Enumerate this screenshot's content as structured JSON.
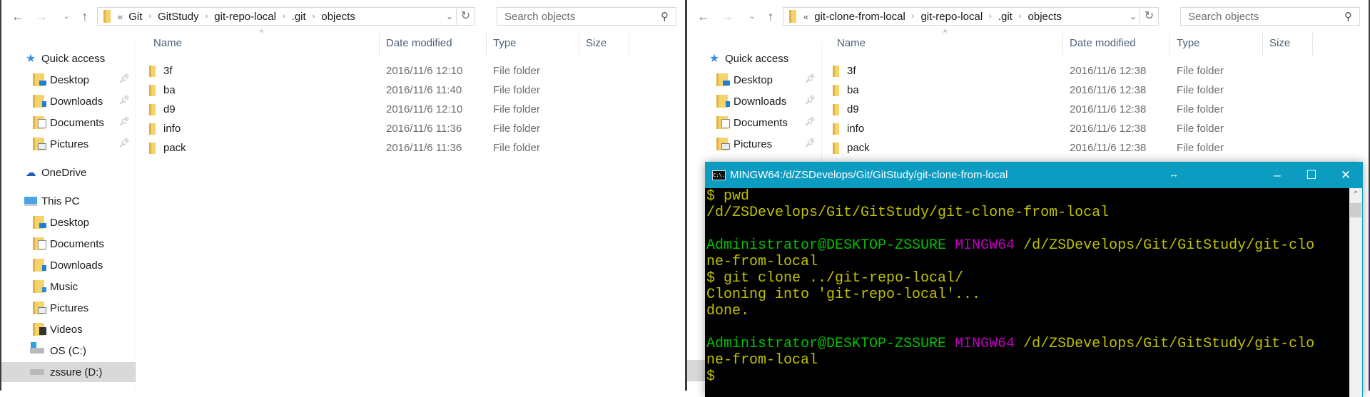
{
  "left_window": {
    "nav": {
      "back": "←",
      "forward": "→",
      "recent": "⌄",
      "up": "↑"
    },
    "address": {
      "overflow": "«",
      "crumbs": [
        "Git",
        "GitStudy",
        "git-repo-local",
        ".git",
        "objects"
      ],
      "separator": "›"
    },
    "search_placeholder": "Search objects",
    "sidebar": {
      "quick_access": "Quick access",
      "pinned": [
        "Desktop",
        "Downloads",
        "Documents",
        "Pictures"
      ],
      "onedrive": "OneDrive",
      "this_pc": "This PC",
      "pc_items": [
        "Desktop",
        "Documents",
        "Downloads",
        "Music",
        "Pictures",
        "Videos"
      ],
      "drives": [
        "OS (C:)",
        "zssure (D:)"
      ],
      "selected": "zssure (D:)"
    },
    "columns": [
      "Name",
      "Date modified",
      "Type",
      "Size"
    ],
    "rows": [
      {
        "name": "3f",
        "date": "2016/11/6 12:10",
        "type": "File folder"
      },
      {
        "name": "ba",
        "date": "2016/11/6 11:40",
        "type": "File folder"
      },
      {
        "name": "d9",
        "date": "2016/11/6 12:10",
        "type": "File folder"
      },
      {
        "name": "info",
        "date": "2016/11/6 11:36",
        "type": "File folder"
      },
      {
        "name": "pack",
        "date": "2016/11/6 11:36",
        "type": "File folder"
      }
    ]
  },
  "right_window": {
    "nav": {
      "back": "←",
      "forward": "→",
      "recent": "⌄",
      "up": "↑"
    },
    "address": {
      "overflow": "«",
      "crumbs": [
        "git-clone-from-local",
        "git-repo-local",
        ".git",
        "objects"
      ],
      "separator": "›"
    },
    "search_placeholder": "Search objects",
    "sidebar": {
      "quick_access": "Quick access",
      "pinned": [
        "Desktop",
        "Downloads",
        "Documents",
        "Pictures"
      ]
    },
    "columns": [
      "Name",
      "Date modified",
      "Type",
      "Size"
    ],
    "rows": [
      {
        "name": "3f",
        "date": "2016/11/6 12:38",
        "type": "File folder"
      },
      {
        "name": "ba",
        "date": "2016/11/6 12:38",
        "type": "File folder"
      },
      {
        "name": "d9",
        "date": "2016/11/6 12:38",
        "type": "File folder"
      },
      {
        "name": "info",
        "date": "2016/11/6 12:38",
        "type": "File folder"
      },
      {
        "name": "pack",
        "date": "2016/11/6 12:38",
        "type": "File folder"
      }
    ]
  },
  "terminal": {
    "title": "MINGW64:/d/ZSDevelops/Git/GitStudy/git-clone-from-local",
    "icon_text": "C:\\.",
    "buttons": {
      "minimize": "–",
      "maximize": "☐",
      "close": "✕",
      "resize": "↔"
    },
    "lines": [
      [
        {
          "t": "$ pwd",
          "c": "yel"
        }
      ],
      [
        {
          "t": "/d/ZSDevelops/Git/GitStudy/git-clone-from-local",
          "c": "yel"
        }
      ],
      [],
      [
        {
          "t": "Administrator@DESKTOP-ZSSURE",
          "c": "green"
        },
        {
          "t": " MINGW64",
          "c": "mag"
        },
        {
          "t": " /d/ZSDevelops/Git/GitStudy/git-clo",
          "c": "yel"
        }
      ],
      [
        {
          "t": "ne-from-local",
          "c": "yel"
        }
      ],
      [
        {
          "t": "$ git clone ../git-repo-local/",
          "c": "yel"
        }
      ],
      [
        {
          "t": "Cloning into 'git-repo-local'...",
          "c": "yel"
        }
      ],
      [
        {
          "t": "done.",
          "c": "yel"
        }
      ],
      [],
      [
        {
          "t": "Administrator@DESKTOP-ZSSURE",
          "c": "green"
        },
        {
          "t": " MINGW64",
          "c": "mag"
        },
        {
          "t": " /d/ZSDevelops/Git/GitStudy/git-clo",
          "c": "yel"
        }
      ],
      [
        {
          "t": "ne-from-local",
          "c": "yel"
        }
      ],
      [
        {
          "t": "$",
          "c": "yel"
        }
      ]
    ]
  },
  "colors": {
    "terminal_title_bar": "#0c9cc1",
    "prompt_user": "#00c000",
    "prompt_mingw": "#c000c0",
    "terminal_text": "#c0c000",
    "folder": "#f5d36b",
    "selected_sidebar": "#d9d9d9"
  }
}
